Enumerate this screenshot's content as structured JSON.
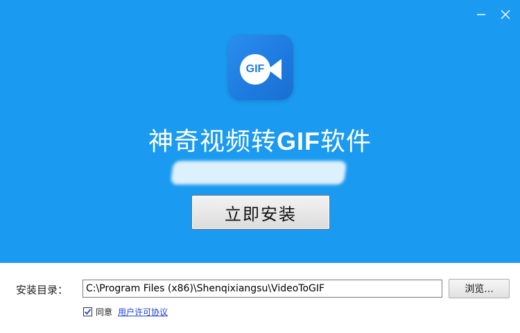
{
  "window": {
    "minimize_icon": "minimize-icon",
    "close_icon": "close-icon"
  },
  "branding": {
    "icon_text": "GIF",
    "title_cn_prefix": "神奇视频转",
    "title_latin": "GIF",
    "title_cn_suffix": "软件"
  },
  "install": {
    "button_label": "立即安装"
  },
  "path": {
    "label": "安装目录：",
    "value": "C:\\Program Files (x86)\\Shenqixiangsu\\VideoToGIF",
    "browse_label": "浏览..."
  },
  "agreement": {
    "checked": true,
    "label": "同意",
    "link_text": "用户许可协议"
  },
  "colors": {
    "hero_background": "#1a9af0",
    "icon_background": "#1f7be0",
    "link": "#1a3fd6"
  }
}
